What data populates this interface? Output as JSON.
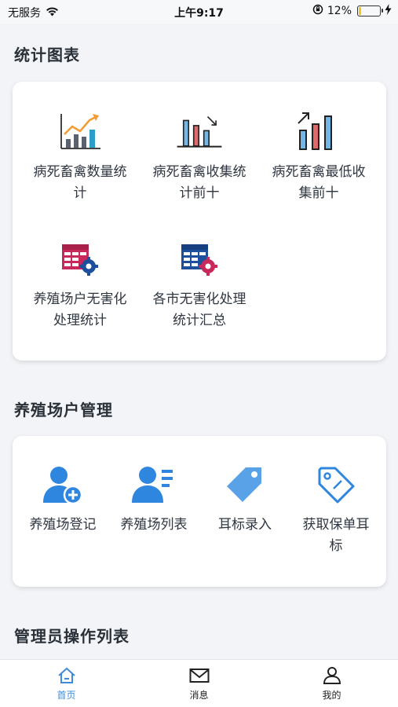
{
  "status_bar": {
    "carrier": "无服务",
    "time": "上午9:17",
    "battery_percent": "12%",
    "battery_level": 0.12,
    "icons": [
      "wifi-icon",
      "orientation-lock-icon",
      "battery-icon",
      "charging-bolt-icon"
    ]
  },
  "colors": {
    "accent": "#3f8bd9",
    "icon_blue": "#2e86de",
    "chart_red": "#d6455a",
    "table_red": "#c8285a",
    "table_blue": "#1d4f9c",
    "background": "#f2f4f7"
  },
  "sections": {
    "stats": {
      "title": "统计图表",
      "items": [
        {
          "line1": "病死畜禽数量统",
          "line2": "计",
          "icon": "bar-chart-trend-icon"
        },
        {
          "line1": "病死畜禽收集统",
          "line2": "计前十",
          "icon": "bar-chart-down-icon"
        },
        {
          "line1": "病死畜禽最低收",
          "line2": "集前十",
          "icon": "bar-chart-up-icon"
        },
        {
          "line1": "养殖场户无害化",
          "line2": "处理统计",
          "icon": "table-settings-icon"
        },
        {
          "line1": "各市无害化处理",
          "line2": "统计汇总",
          "icon": "table-settings-icon"
        }
      ]
    },
    "farm": {
      "title": "养殖场户管理",
      "items": [
        {
          "line1": "养殖场登记",
          "line2": "",
          "icon": "user-add-icon"
        },
        {
          "line1": "养殖场列表",
          "line2": "",
          "icon": "user-list-icon"
        },
        {
          "line1": "耳标录入",
          "line2": "",
          "icon": "tag-icon"
        },
        {
          "line1": "获取保单耳",
          "line2": "标",
          "icon": "tag-outline-icon"
        }
      ]
    },
    "admin": {
      "title": "管理员操作列表"
    }
  },
  "tab_bar": {
    "tabs": [
      {
        "label": "首页",
        "icon": "home-icon",
        "active": true
      },
      {
        "label": "消息",
        "icon": "mail-icon",
        "active": false
      },
      {
        "label": "我的",
        "icon": "user-icon",
        "active": false
      }
    ]
  }
}
